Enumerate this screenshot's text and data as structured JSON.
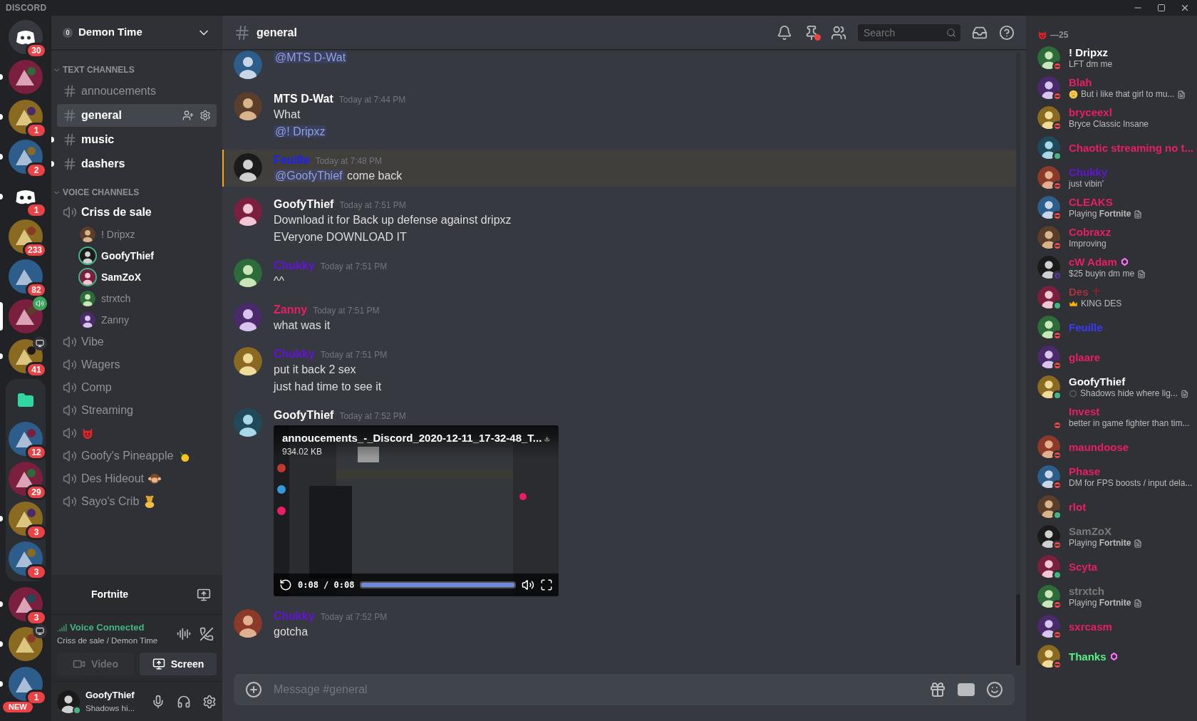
{
  "titlebar": {
    "wordmark": "DISCORD"
  },
  "servers": [
    {
      "kind": "home",
      "badge": "30",
      "unread": false,
      "selected": false
    },
    {
      "kind": "picture",
      "unread": true,
      "selected": false
    },
    {
      "kind": "picture",
      "badge": "1",
      "unread": true,
      "selected": false
    },
    {
      "kind": "picture",
      "badge": "2",
      "unread": true,
      "selected": false
    },
    {
      "kind": "logo",
      "badge": "1",
      "unread": true,
      "selected": false
    },
    {
      "kind": "picture",
      "badge": "233",
      "unread": false,
      "selected": false
    },
    {
      "kind": "picture",
      "badge": "82",
      "unread": false,
      "selected": false
    },
    {
      "kind": "voice",
      "unread": false,
      "selected": true
    },
    {
      "kind": "screen",
      "badge": "41",
      "unread": true,
      "selected": false
    },
    {
      "kind": "folder",
      "children": [
        {
          "kind": "picture",
          "badge": "12",
          "unread": false,
          "selected": false
        },
        {
          "kind": "picture",
          "badge": "29",
          "unread": false,
          "selected": false
        },
        {
          "kind": "picture",
          "badge": "3",
          "unread": true,
          "selected": false
        },
        {
          "kind": "picture",
          "badge": "3",
          "unread": false,
          "selected": false
        }
      ]
    },
    {
      "kind": "picture",
      "badge": "3",
      "unread": true,
      "selected": false
    },
    {
      "kind": "screen",
      "unread": true,
      "selected": false
    },
    {
      "kind": "picture",
      "badge": "1",
      "tag": "NEW",
      "unread": true,
      "selected": false
    }
  ],
  "server": {
    "name": "Demon Time"
  },
  "categories": [
    {
      "label": "TEXT CHANNELS",
      "kind": "text",
      "channels": [
        {
          "name": "annoucements",
          "selected": false,
          "unread": false
        },
        {
          "name": "general",
          "selected": true,
          "unread": false
        },
        {
          "name": "music",
          "selected": false,
          "unread": true
        },
        {
          "name": "dashers",
          "selected": false,
          "unread": true
        }
      ]
    },
    {
      "label": "VOICE CHANNELS",
      "kind": "voice",
      "channels": [
        {
          "name": "Criss de sale",
          "kind": "plain",
          "users": [
            {
              "name": "! Dripxz",
              "speaking": false
            },
            {
              "name": "GoofyThief",
              "speaking": true
            },
            {
              "name": "SamZoX",
              "speaking": true
            },
            {
              "name": "strxtch",
              "speaking": false
            },
            {
              "name": "Zanny",
              "speaking": false
            }
          ]
        },
        {
          "name": "Vibe",
          "kind": "plain"
        },
        {
          "name": "Wagers",
          "kind": "plain"
        },
        {
          "name": "Comp",
          "kind": "plain"
        },
        {
          "name": "Streaming",
          "kind": "plain"
        },
        {
          "kind": "devil"
        },
        {
          "name": "Goofy's Pineapple",
          "kind": "pineapple"
        },
        {
          "name": "Des Hideout",
          "kind": "monkey"
        },
        {
          "name": "Sayo's Crib",
          "kind": "bear"
        }
      ]
    }
  ],
  "activity": {
    "game": "Fortnite"
  },
  "voice": {
    "status": "Voice Connected",
    "location": "Criss de sale / Demon Time",
    "buttons": [
      {
        "label": "Video",
        "selected": false
      },
      {
        "label": "Screen",
        "selected": true
      }
    ]
  },
  "user": {
    "name": "GoofyThief",
    "status_text": "Shadows hi...",
    "status": {
      "kind": "online",
      "color": "#43b581"
    }
  },
  "header": {
    "channel": "general",
    "pins_unread": true,
    "search_placeholder": "Search"
  },
  "messages": [
    {
      "lines": [
        {
          "mention": "@MTS D-Wat"
        }
      ],
      "highlighted": false
    },
    {
      "author": "MTS D-Wat",
      "color": "#ffffff",
      "time": "Today at 7:44 PM",
      "lines": [
        {
          "text": "What"
        },
        {
          "mention": "@! Dripxz"
        }
      ],
      "highlighted": false
    },
    {
      "author": "Feuille",
      "color": "#2020ff",
      "time": "Today at 7:48 PM",
      "lines": [
        {
          "mention": "@GoofyThief",
          "text": "come back"
        }
      ],
      "highlighted": true
    },
    {
      "author": "GoofyThief",
      "color": "#ffffff",
      "time": "Today at 7:51 PM",
      "lines": [
        {
          "text": "Download it for Back up defense against dripxz"
        },
        {
          "text": "EVeryone DOWNLOAD IT"
        }
      ],
      "highlighted": false
    },
    {
      "author": "Chukky",
      "color": "#6214d6",
      "time": "Today at 7:51 PM",
      "lines": [
        {
          "text": "^^"
        }
      ],
      "highlighted": false
    },
    {
      "author": "Zanny",
      "color": "#e91e63",
      "time": "Today at 7:51 PM",
      "lines": [
        {
          "text": "what was it"
        }
      ],
      "highlighted": false
    },
    {
      "author": "Chukky",
      "color": "#6214d6",
      "time": "Today at 7:51 PM",
      "lines": [
        {
          "text": "put it back 2 sex"
        },
        {
          "text": "just had time to see it"
        }
      ],
      "highlighted": false
    },
    {
      "author": "GoofyThief",
      "color": "#ffffff",
      "time": "Today at 7:52 PM",
      "video": {
        "title": "annoucements_-_Discord_2020-12-11_17-32-48_T...",
        "size": "934.02 KB",
        "time": "0:08 / 0:08",
        "level": 1
      },
      "highlighted": false
    },
    {
      "author": "Chukky",
      "color": "#6214d6",
      "time": "Today at 7:52 PM",
      "lines": [
        {
          "text": "gotcha"
        }
      ],
      "highlighted": false
    }
  ],
  "composer": {
    "placeholder": "Message #general"
  },
  "member_group": {
    "label": "—25"
  },
  "members": [
    {
      "name": "! Dripxz",
      "color": "#ffffff",
      "kind": "plain",
      "status": {
        "kind": "dnd",
        "color": "#f04747"
      },
      "avatar": true,
      "activity": "LFT dm me",
      "note": false
    },
    {
      "name": "Blah",
      "color": "#e91e63",
      "kind": "sad",
      "status": {
        "kind": "dnd",
        "color": "#f04747"
      },
      "avatar": true,
      "activity": "But i like that girl to mu...",
      "note": true
    },
    {
      "name": "bryceexl",
      "color": "#e91e63",
      "kind": "plain",
      "status": {
        "kind": "dnd",
        "color": "#f04747"
      },
      "avatar": true,
      "activity": "Bryce Classic Insane",
      "note": false
    },
    {
      "name": "Chaotic streaming no t...",
      "color": "#e91e63",
      "kind": "plain",
      "status": {
        "kind": "online",
        "color": "#43b581"
      },
      "avatar": true,
      "note": false
    },
    {
      "name": "Chukky",
      "color": "#6214d6",
      "kind": "plain",
      "status": {
        "kind": "dnd",
        "color": "#f04747"
      },
      "avatar": true,
      "activity": "just vibin'",
      "note": false
    },
    {
      "name": "CLEAKS",
      "color": "#e91e63",
      "kind": "plain",
      "status": {
        "kind": "dnd",
        "color": "#f04747"
      },
      "avatar": true,
      "activity": "Playing **Fortnite**",
      "note": true
    },
    {
      "name": "Cobraxz",
      "color": "#e91e63",
      "kind": "plain",
      "status": {
        "kind": "dnd",
        "color": "#f04747"
      },
      "avatar": true,
      "activity": "Improving",
      "note": false
    },
    {
      "name": "cW Adam",
      "color": "#e91e63",
      "kind": "booster",
      "status": {
        "kind": "streaming",
        "color": "#593695"
      },
      "avatar": true,
      "activity": "$25 buyin dm me",
      "note": true
    },
    {
      "name": "Des",
      "color": "#a8323e",
      "kind": "crowned",
      "status": {
        "kind": "online",
        "color": "#43b581"
      },
      "avatar": true,
      "activity": "KING DES",
      "note": false
    },
    {
      "name": "Feuille",
      "color": "#3a3aff",
      "kind": "plain",
      "status": {
        "kind": "dnd",
        "color": "#f04747"
      },
      "avatar": true,
      "note": false
    },
    {
      "name": "glaare",
      "color": "#e91e63",
      "kind": "plain",
      "status": {
        "kind": "dnd",
        "color": "#f04747"
      },
      "avatar": true,
      "note": false
    },
    {
      "name": "GoofyThief",
      "color": "#ffffff",
      "kind": "ring",
      "status": {
        "kind": "online",
        "color": "#43b581"
      },
      "avatar": true,
      "activity": "Shadows hide where lig...",
      "note": true
    },
    {
      "name": "Invest",
      "color": "#e91e63",
      "kind": "plain",
      "status": {
        "kind": "dnd",
        "color": "#f04747"
      },
      "avatar": false,
      "activity": "better in game fighter than tim...",
      "note": false
    },
    {
      "name": "maundoose",
      "color": "#e91e63",
      "kind": "plain",
      "status": {
        "kind": "dnd",
        "color": "#f04747"
      },
      "avatar": true,
      "note": false
    },
    {
      "name": "Phase",
      "color": "#e91e63",
      "kind": "plain",
      "status": {
        "kind": "dnd",
        "color": "#f04747"
      },
      "avatar": true,
      "activity": "DM for FPS boosts / input dela...",
      "note": false
    },
    {
      "name": "rlot",
      "color": "#e91e63",
      "kind": "plain",
      "status": {
        "kind": "online",
        "color": "#43b581"
      },
      "avatar": true,
      "note": false
    },
    {
      "name": "SamZoX",
      "color": "#7a7a7a",
      "kind": "plain",
      "status": {
        "kind": "dnd",
        "color": "#f04747"
      },
      "avatar": true,
      "activity": "Playing **Fortnite**",
      "note": true
    },
    {
      "name": "Scyta",
      "color": "#e91e63",
      "kind": "plain",
      "status": {
        "kind": "online",
        "color": "#43b581"
      },
      "avatar": true,
      "note": false
    },
    {
      "name": "strxtch",
      "color": "#7a7a7a",
      "kind": "plain",
      "status": {
        "kind": "dnd",
        "color": "#f04747"
      },
      "avatar": true,
      "activity": "Playing **Fortnite**",
      "note": true
    },
    {
      "name": "sxrcasm",
      "color": "#e91e63",
      "kind": "plain",
      "status": {
        "kind": "dnd",
        "color": "#f04747"
      },
      "avatar": true,
      "note": false
    },
    {
      "name": "Thanks",
      "color": "#57f287",
      "kind": "booster",
      "status": {
        "kind": "dnd",
        "color": "#f04747"
      },
      "avatar": true,
      "note": false
    }
  ]
}
